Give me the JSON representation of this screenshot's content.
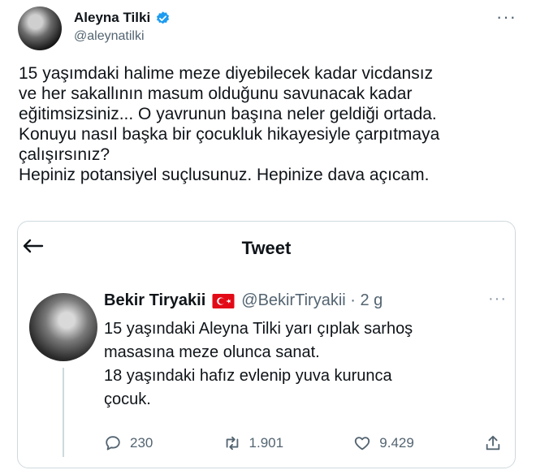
{
  "author": {
    "display_name": "Aleyna Tilki",
    "handle": "@aleynatilki"
  },
  "tweet": {
    "text": "15 yaşımdaki halime meze diyebilecek kadar vicdansız\nve her sakallının masum olduğunu savunacak kadar\neğitimsizsiniz... O yavrunun başına neler geldiği ortada.\nKonuyu nasıl başka bir çocukluk hikayesiyle çarpıtmaya\nçalışırsınız?\nHepiniz potansiyel suçlusunuz. Hepinize dava açıcam."
  },
  "quote": {
    "page_title": "Tweet",
    "name": "Bekir Tiryakii",
    "handle_time": "@BekirTiryakii · 2 g",
    "text": "15 yaşındaki Aleyna Tilki yarı çıplak sarhoş\nmasasına meze olunca sanat.\n18 yaşındaki hafız evlenip yuva kurunca\nçocuk.",
    "replies": "230",
    "retweets": "1.901",
    "likes": "9.429"
  },
  "colors": {
    "text": "#0f1419",
    "secondary": "#536471",
    "verified": "#1d9bf0",
    "border": "#cfd9de",
    "flag_red": "#e30a17"
  },
  "icons": [
    "verified-badge-icon",
    "more-icon",
    "back-arrow-icon",
    "turkey-flag-icon",
    "reply-icon",
    "retweet-icon",
    "like-icon",
    "share-icon"
  ]
}
